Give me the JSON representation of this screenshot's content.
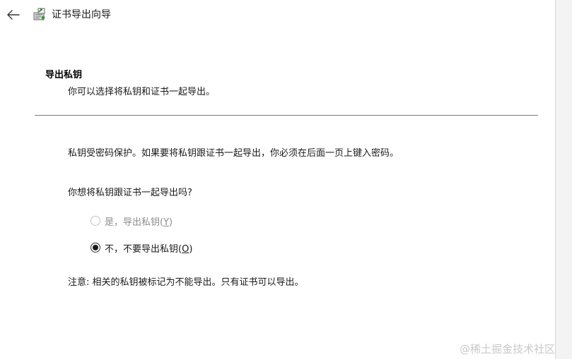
{
  "window": {
    "title": "证书导出向导"
  },
  "icons": {
    "back": "arrow-left-icon",
    "app": "certificate-export-icon"
  },
  "section": {
    "title": "导出私钥",
    "description": "你可以选择将私钥和证书一起导出。"
  },
  "body": {
    "info": "私钥受密码保护。如果要将私钥跟证书一起导出，你必须在后面一页上键入密码。",
    "question": "你想将私钥跟证书一起导出吗?",
    "options": [
      {
        "prefix": "是，导出私钥(",
        "key": "Y",
        "suffix": ")",
        "selected": false,
        "disabled": true
      },
      {
        "prefix": "不，不要导出私钥(",
        "key": "O",
        "suffix": ")",
        "selected": true,
        "disabled": false
      }
    ],
    "note": "注意: 相关的私钥被标记为不能导出。只有证书可以导出。"
  },
  "watermark": "@稀土掘金技术社区",
  "colors": {
    "background": "#ffffff",
    "text": "#1a1a1a",
    "disabled_text": "#8c8c8c",
    "divider": "#7a7a7a",
    "watermark": "#c9c9c9"
  }
}
